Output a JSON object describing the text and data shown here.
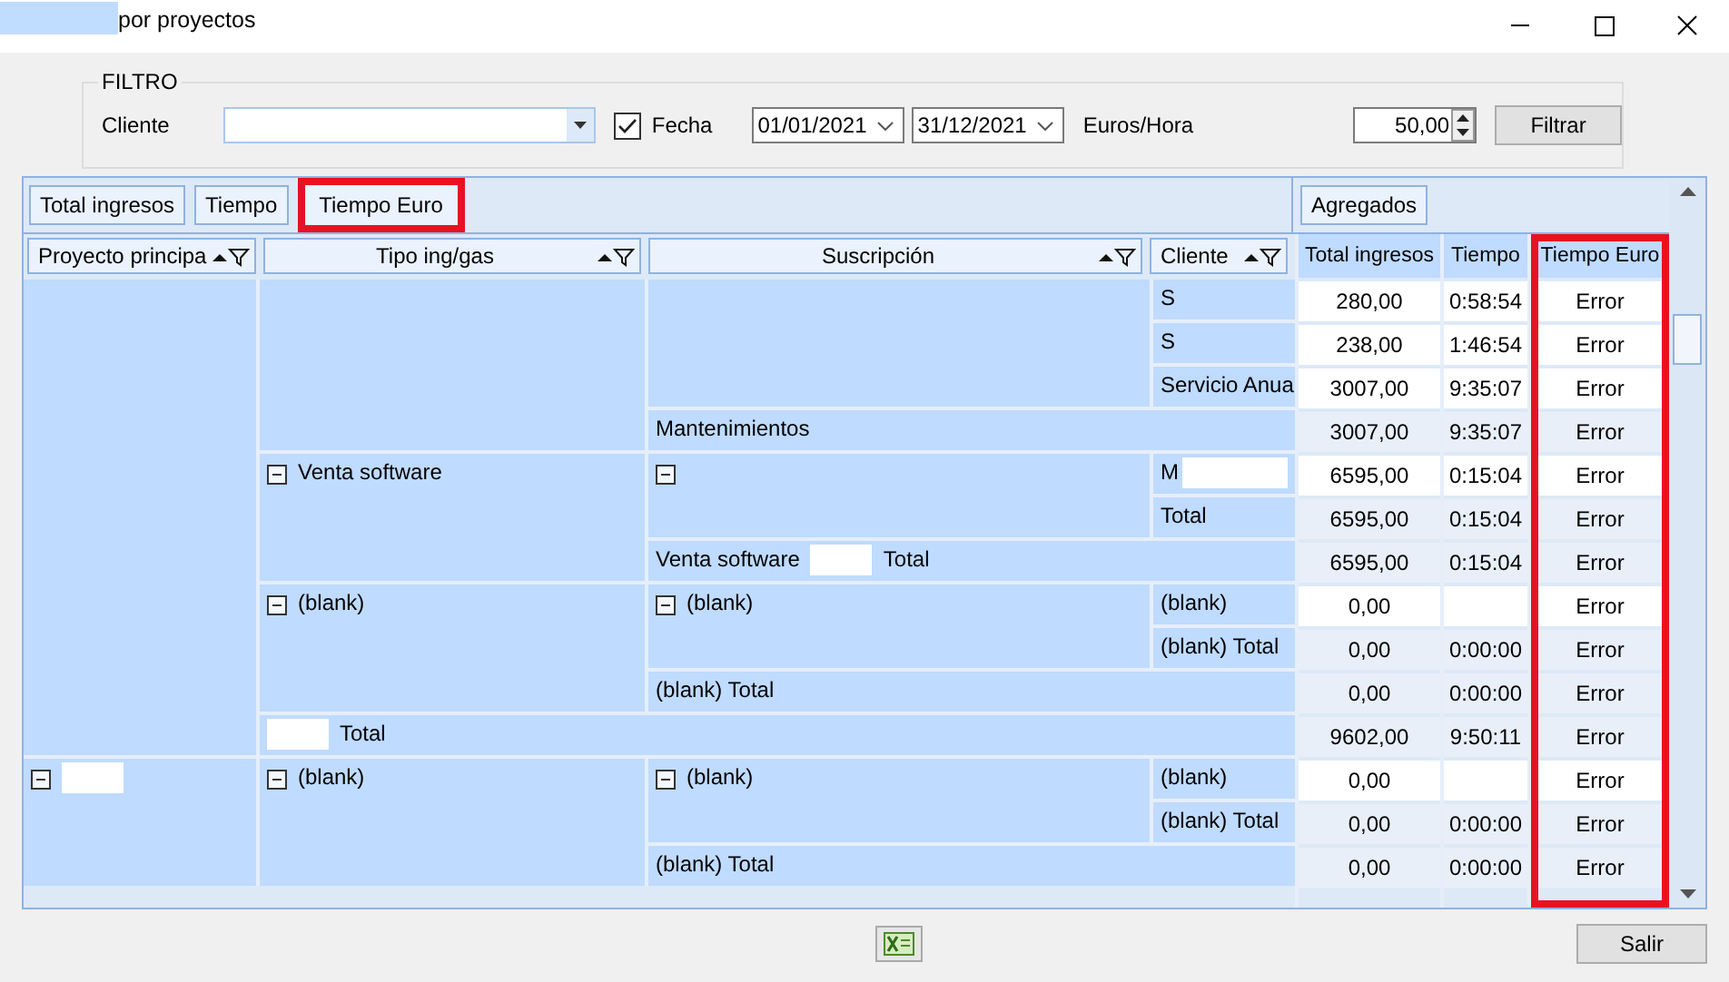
{
  "window": {
    "title": "por proyectos",
    "title_redacted": true
  },
  "filter": {
    "title": "FILTRO",
    "cliente_label": "Cliente",
    "fecha": {
      "label": "Fecha",
      "checked": true
    },
    "date_from": "01/01/2021",
    "date_to": "31/12/2021",
    "rate_label": "Euros/Hora",
    "rate_value": "50,00",
    "filter_button": "Filtrar"
  },
  "pivot": {
    "data_fields": [
      {
        "label": "Total ingresos",
        "highlighted": false
      },
      {
        "label": "Tiempo",
        "highlighted": false
      },
      {
        "label": "Tiempo Euro",
        "highlighted": true
      }
    ],
    "aggregates_button": "Agregados",
    "row_fields": [
      {
        "label": "Proyecto principa"
      },
      {
        "label": "Tipo ing/gas"
      },
      {
        "label": "Suscripción"
      },
      {
        "label": "Cliente"
      }
    ],
    "data_columns": [
      {
        "label": "Total ingresos",
        "highlighted": false
      },
      {
        "label": "Tiempo",
        "highlighted": false
      },
      {
        "label": "Tiempo Euro",
        "highlighted": true
      }
    ],
    "groups": [
      {
        "total": {
          "redacted": true,
          "suffix": "Total",
          "values": {
            "total_ingresos": "9602,00",
            "tiempo": "9:50:11",
            "tiempo_euro": "Error"
          }
        },
        "children": [
          {
            "total": {
              "label": "Mantenimientos",
              "values": {
                "total_ingresos": "3007,00",
                "tiempo": "9:35:07",
                "tiempo_euro": "Error"
              }
            },
            "children": [
              {
                "children": [
                  {
                    "label": "S",
                    "values": {
                      "total_ingresos": "280,00",
                      "tiempo": "0:58:54",
                      "tiempo_euro": "Error"
                    }
                  },
                  {
                    "label": "S",
                    "values": {
                      "total_ingresos": "238,00",
                      "tiempo": "1:46:54",
                      "tiempo_euro": "Error"
                    }
                  },
                  {
                    "label": "Servicio Anua",
                    "values": {
                      "total_ingresos": "3007,00",
                      "tiempo": "9:35:07",
                      "tiempo_euro": "Error"
                    }
                  }
                ]
              }
            ]
          },
          {
            "label": "Venta software",
            "expander": true,
            "total": {
              "label": "Venta software",
              "redacted": true,
              "suffix": "Total",
              "values": {
                "total_ingresos": "6595,00",
                "tiempo": "0:15:04",
                "tiempo_euro": "Error"
              }
            },
            "children": [
              {
                "expander": true,
                "total": {
                  "label": "Total",
                  "values": {
                    "total_ingresos": "6595,00",
                    "tiempo": "0:15:04",
                    "tiempo_euro": "Error"
                  }
                },
                "children": [
                  {
                    "label": "M",
                    "redacted": true,
                    "values": {
                      "total_ingresos": "6595,00",
                      "tiempo": "0:15:04",
                      "tiempo_euro": "Error"
                    }
                  }
                ]
              }
            ]
          },
          {
            "label": "(blank)",
            "expander": true,
            "total": {
              "label": "(blank) Total",
              "values": {
                "total_ingresos": "0,00",
                "tiempo": "0:00:00",
                "tiempo_euro": "Error"
              }
            },
            "children": [
              {
                "label": "(blank)",
                "expander": true,
                "total": {
                  "label": "(blank) Total",
                  "values": {
                    "total_ingresos": "0,00",
                    "tiempo": "0:00:00",
                    "tiempo_euro": "Error"
                  }
                },
                "children": [
                  {
                    "label": "(blank)",
                    "values": {
                      "total_ingresos": "0,00",
                      "tiempo_euro": "Error"
                    }
                  }
                ]
              }
            ]
          }
        ]
      },
      {
        "expander": true,
        "redacted": true,
        "children": [
          {
            "label": "(blank)",
            "expander": true,
            "total": {
              "label": "(blank) Total",
              "values": {
                "total_ingresos": "0,00",
                "tiempo": "0:00:00",
                "tiempo_euro": "Error"
              }
            },
            "children": [
              {
                "label": "(blank)",
                "expander": true,
                "total": {
                  "label": "(blank) Total",
                  "values": {
                    "total_ingresos": "0,00",
                    "tiempo": "0:00:00",
                    "tiempo_euro": "Error"
                  }
                },
                "children": [
                  {
                    "label": "(blank)",
                    "values": {
                      "total_ingresos": "0,00",
                      "tiempo_euro": "Error"
                    }
                  }
                ]
              }
            ]
          }
        ]
      }
    ]
  },
  "footer": {
    "close_button": "Salir"
  }
}
